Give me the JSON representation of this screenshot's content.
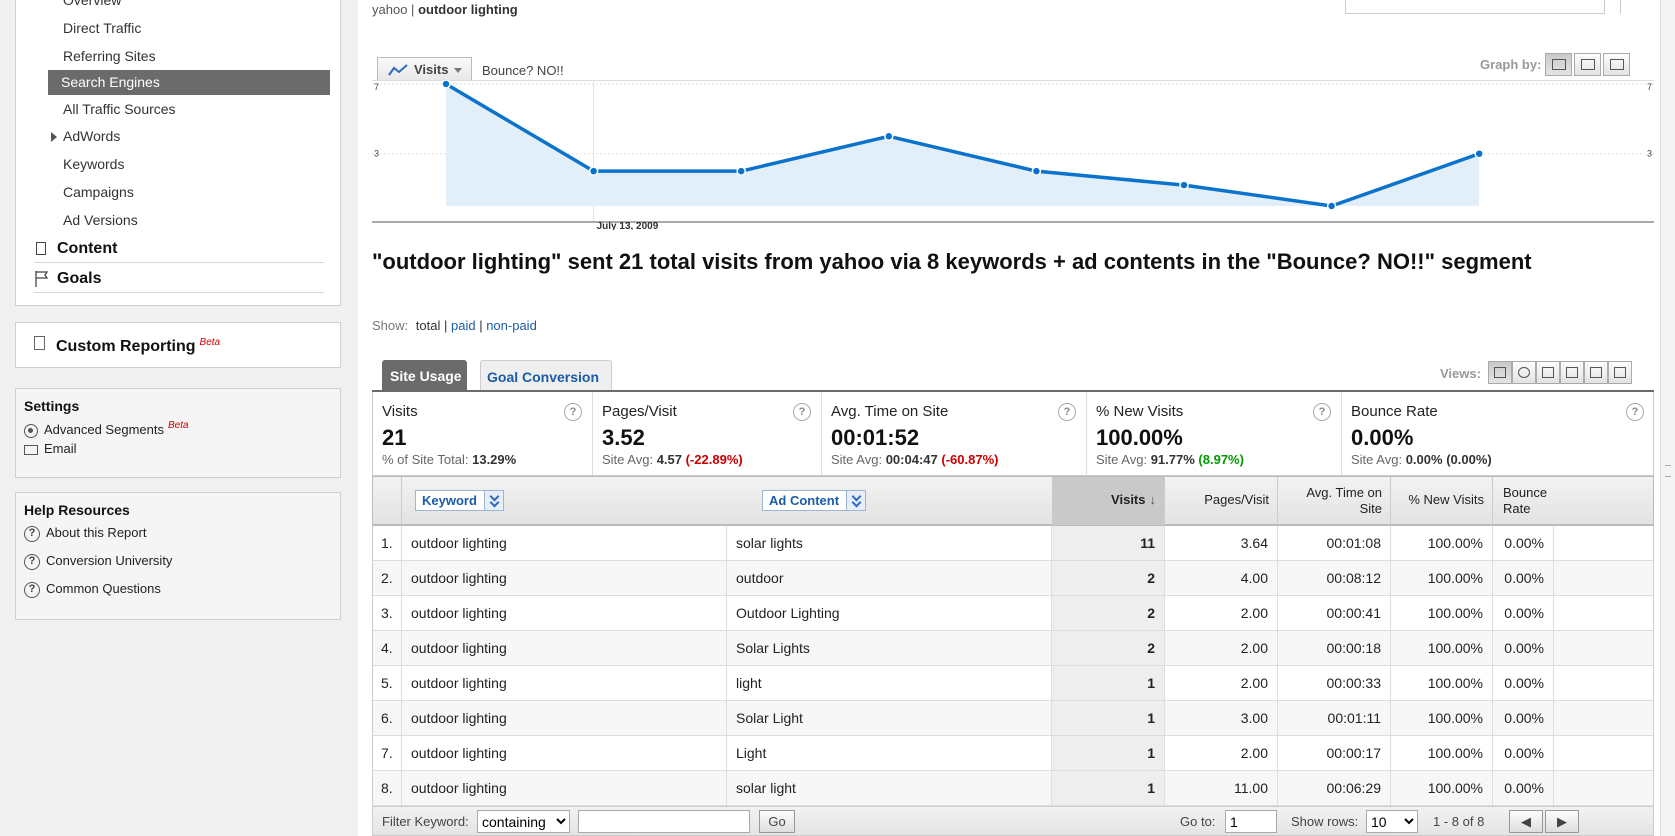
{
  "nav": {
    "items": [
      {
        "label": "Overview"
      },
      {
        "label": "Direct Traffic"
      },
      {
        "label": "Referring Sites"
      },
      {
        "label": "Search Engines"
      },
      {
        "label": "All Traffic Sources"
      },
      {
        "label": "AdWords"
      },
      {
        "label": "Keywords"
      },
      {
        "label": "Campaigns"
      },
      {
        "label": "Ad Versions"
      }
    ],
    "content": "Content",
    "goals": "Goals",
    "custom_reporting": "Custom Reporting",
    "beta": "Beta"
  },
  "settings": {
    "title": "Settings",
    "advanced_segments": "Advanced Segments",
    "email": "Email"
  },
  "help": {
    "title": "Help Resources",
    "items": [
      "About this Report",
      "Conversion University",
      "Common Questions"
    ]
  },
  "breadcrumb": {
    "source": "yahoo",
    "separator": "|",
    "keyword": "outdoor lighting"
  },
  "graph": {
    "metric_tab": "Visits",
    "segment_label": "Bounce? NO!!",
    "graph_by_label": "Graph by:"
  },
  "chart_data": {
    "type": "area",
    "series": [
      {
        "name": "Visits",
        "values": [
          7,
          2,
          2,
          4,
          2,
          1.2,
          0,
          3
        ]
      }
    ],
    "ylim": [
      0,
      7
    ],
    "yticks_left": [
      "7",
      "3"
    ],
    "yticks_right": [
      "7",
      "3"
    ],
    "x_tick_label": "July 13, 2009",
    "color": "#0b73cc",
    "fill": "#e3eff8"
  },
  "headline": "\"outdoor lighting\" sent 21 total visits from yahoo via 8 keywords + ad contents in the \"Bounce? NO!!\" segment",
  "show": {
    "label": "Show:",
    "total": "total",
    "sep": "|",
    "paid": "paid",
    "nonpaid": "non-paid"
  },
  "tabs": {
    "site_usage": "Site Usage",
    "goal_conversion": "Goal Conversion",
    "views_label": "Views:"
  },
  "scorecards": [
    {
      "name": "Visits",
      "value": "21",
      "sub_label": "% of Site Total:",
      "sub_value": "13.29%",
      "change": "",
      "change_class": ""
    },
    {
      "name": "Pages/Visit",
      "value": "3.52",
      "sub_label": "Site Avg:",
      "sub_value": "4.57",
      "change": "(-22.89%)",
      "change_class": "neg"
    },
    {
      "name": "Avg. Time on Site",
      "value": "00:01:52",
      "sub_label": "Site Avg:",
      "sub_value": "00:04:47",
      "change": "(-60.87%)",
      "change_class": "neg"
    },
    {
      "name": "% New Visits",
      "value": "100.00%",
      "sub_label": "Site Avg:",
      "sub_value": "91.77%",
      "change": "(8.97%)",
      "change_class": "pos"
    },
    {
      "name": "Bounce Rate",
      "value": "0.00%",
      "sub_label": "Site Avg:",
      "sub_value": "0.00%",
      "change": "(0.00%)",
      "change_class": ""
    }
  ],
  "help_glyph": "?",
  "table": {
    "headers": {
      "keyword": "Keyword",
      "ad_content": "Ad Content",
      "visits": "Visits",
      "pages_visit": "Pages/Visit",
      "avg_time": "Avg. Time on Site",
      "new_visits": "% New Visits",
      "bounce": "Bounce Rate"
    },
    "rows": [
      {
        "n": "1.",
        "keyword": "outdoor lighting",
        "ad": "solar lights",
        "visits": "11",
        "pv": "3.64",
        "time": "00:01:08",
        "new": "100.00%",
        "bounce": "0.00%"
      },
      {
        "n": "2.",
        "keyword": "outdoor lighting",
        "ad": "outdoor",
        "visits": "2",
        "pv": "4.00",
        "time": "00:08:12",
        "new": "100.00%",
        "bounce": "0.00%"
      },
      {
        "n": "3.",
        "keyword": "outdoor lighting",
        "ad": "Outdoor Lighting",
        "visits": "2",
        "pv": "2.00",
        "time": "00:00:41",
        "new": "100.00%",
        "bounce": "0.00%"
      },
      {
        "n": "4.",
        "keyword": "outdoor lighting",
        "ad": "Solar Lights",
        "visits": "2",
        "pv": "2.00",
        "time": "00:00:18",
        "new": "100.00%",
        "bounce": "0.00%"
      },
      {
        "n": "5.",
        "keyword": "outdoor lighting",
        "ad": "light",
        "visits": "1",
        "pv": "2.00",
        "time": "00:00:33",
        "new": "100.00%",
        "bounce": "0.00%"
      },
      {
        "n": "6.",
        "keyword": "outdoor lighting",
        "ad": "Solar Light",
        "visits": "1",
        "pv": "3.00",
        "time": "00:01:11",
        "new": "100.00%",
        "bounce": "0.00%"
      },
      {
        "n": "7.",
        "keyword": "outdoor lighting",
        "ad": "Light",
        "visits": "1",
        "pv": "2.00",
        "time": "00:00:17",
        "new": "100.00%",
        "bounce": "0.00%"
      },
      {
        "n": "8.",
        "keyword": "outdoor lighting",
        "ad": "solar light",
        "visits": "1",
        "pv": "11.00",
        "time": "00:06:29",
        "new": "100.00%",
        "bounce": "0.00%"
      }
    ]
  },
  "footer": {
    "filter_label": "Filter Keyword:",
    "filter_mode": "containing",
    "filter_value": "",
    "go_label": "Go",
    "goto_label": "Go to:",
    "goto_value": "1",
    "show_rows_label": "Show rows:",
    "show_rows_value": "10",
    "range": "1 - 8 of 8"
  }
}
